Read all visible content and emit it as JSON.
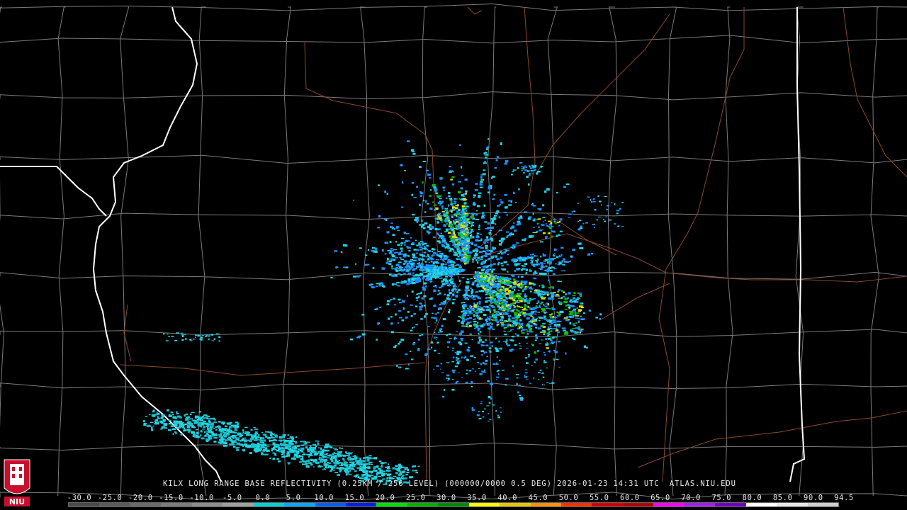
{
  "caption": "KILX LONG RANGE BASE REFLECTIVITY (0.25KM / 256 LEVEL) (000000/0000 0.5 DEG) 2026-01-23 14:31 UTC  ATLAS.NIU.EDU",
  "logo_text": "NIU",
  "colors": {
    "background": "#000000",
    "county_lines": "#7a7a7a",
    "state_lines": "#ffffff",
    "highways": "#8a4a2a",
    "light_echo": "#22d3e0",
    "medium_echo": "#1e90ff",
    "strong_echo": "#00c000",
    "heavy_echo": "#e0e000"
  },
  "scale": {
    "labels": [
      "-30.0",
      "-25.0",
      "-20.0",
      "-15.0",
      "-10.0",
      "-5.0",
      "0.0",
      "5.0",
      "10.0",
      "15.0",
      "20.0",
      "25.0",
      "30.0",
      "35.0",
      "40.0",
      "45.0",
      "50.0",
      "55.0",
      "60.0",
      "65.0",
      "70.0",
      "75.0",
      "80.0",
      "85.0",
      "90.0",
      "94.5"
    ],
    "colors": [
      "#4a4a4a",
      "#5a5a5a",
      "#6a6a6a",
      "#7c7c7c",
      "#8e8e8e",
      "#a0a0a0",
      "#00d2d2",
      "#00aaff",
      "#0060ff",
      "#0020e0",
      "#00e000",
      "#00b000",
      "#008a00",
      "#ffff00",
      "#e6c800",
      "#ff9000",
      "#ff3000",
      "#d00000",
      "#b00000",
      "#ff00ff",
      "#a020f0",
      "#7000c0",
      "#ffffff",
      "#e8e8e8",
      "#d0d0d0"
    ]
  }
}
